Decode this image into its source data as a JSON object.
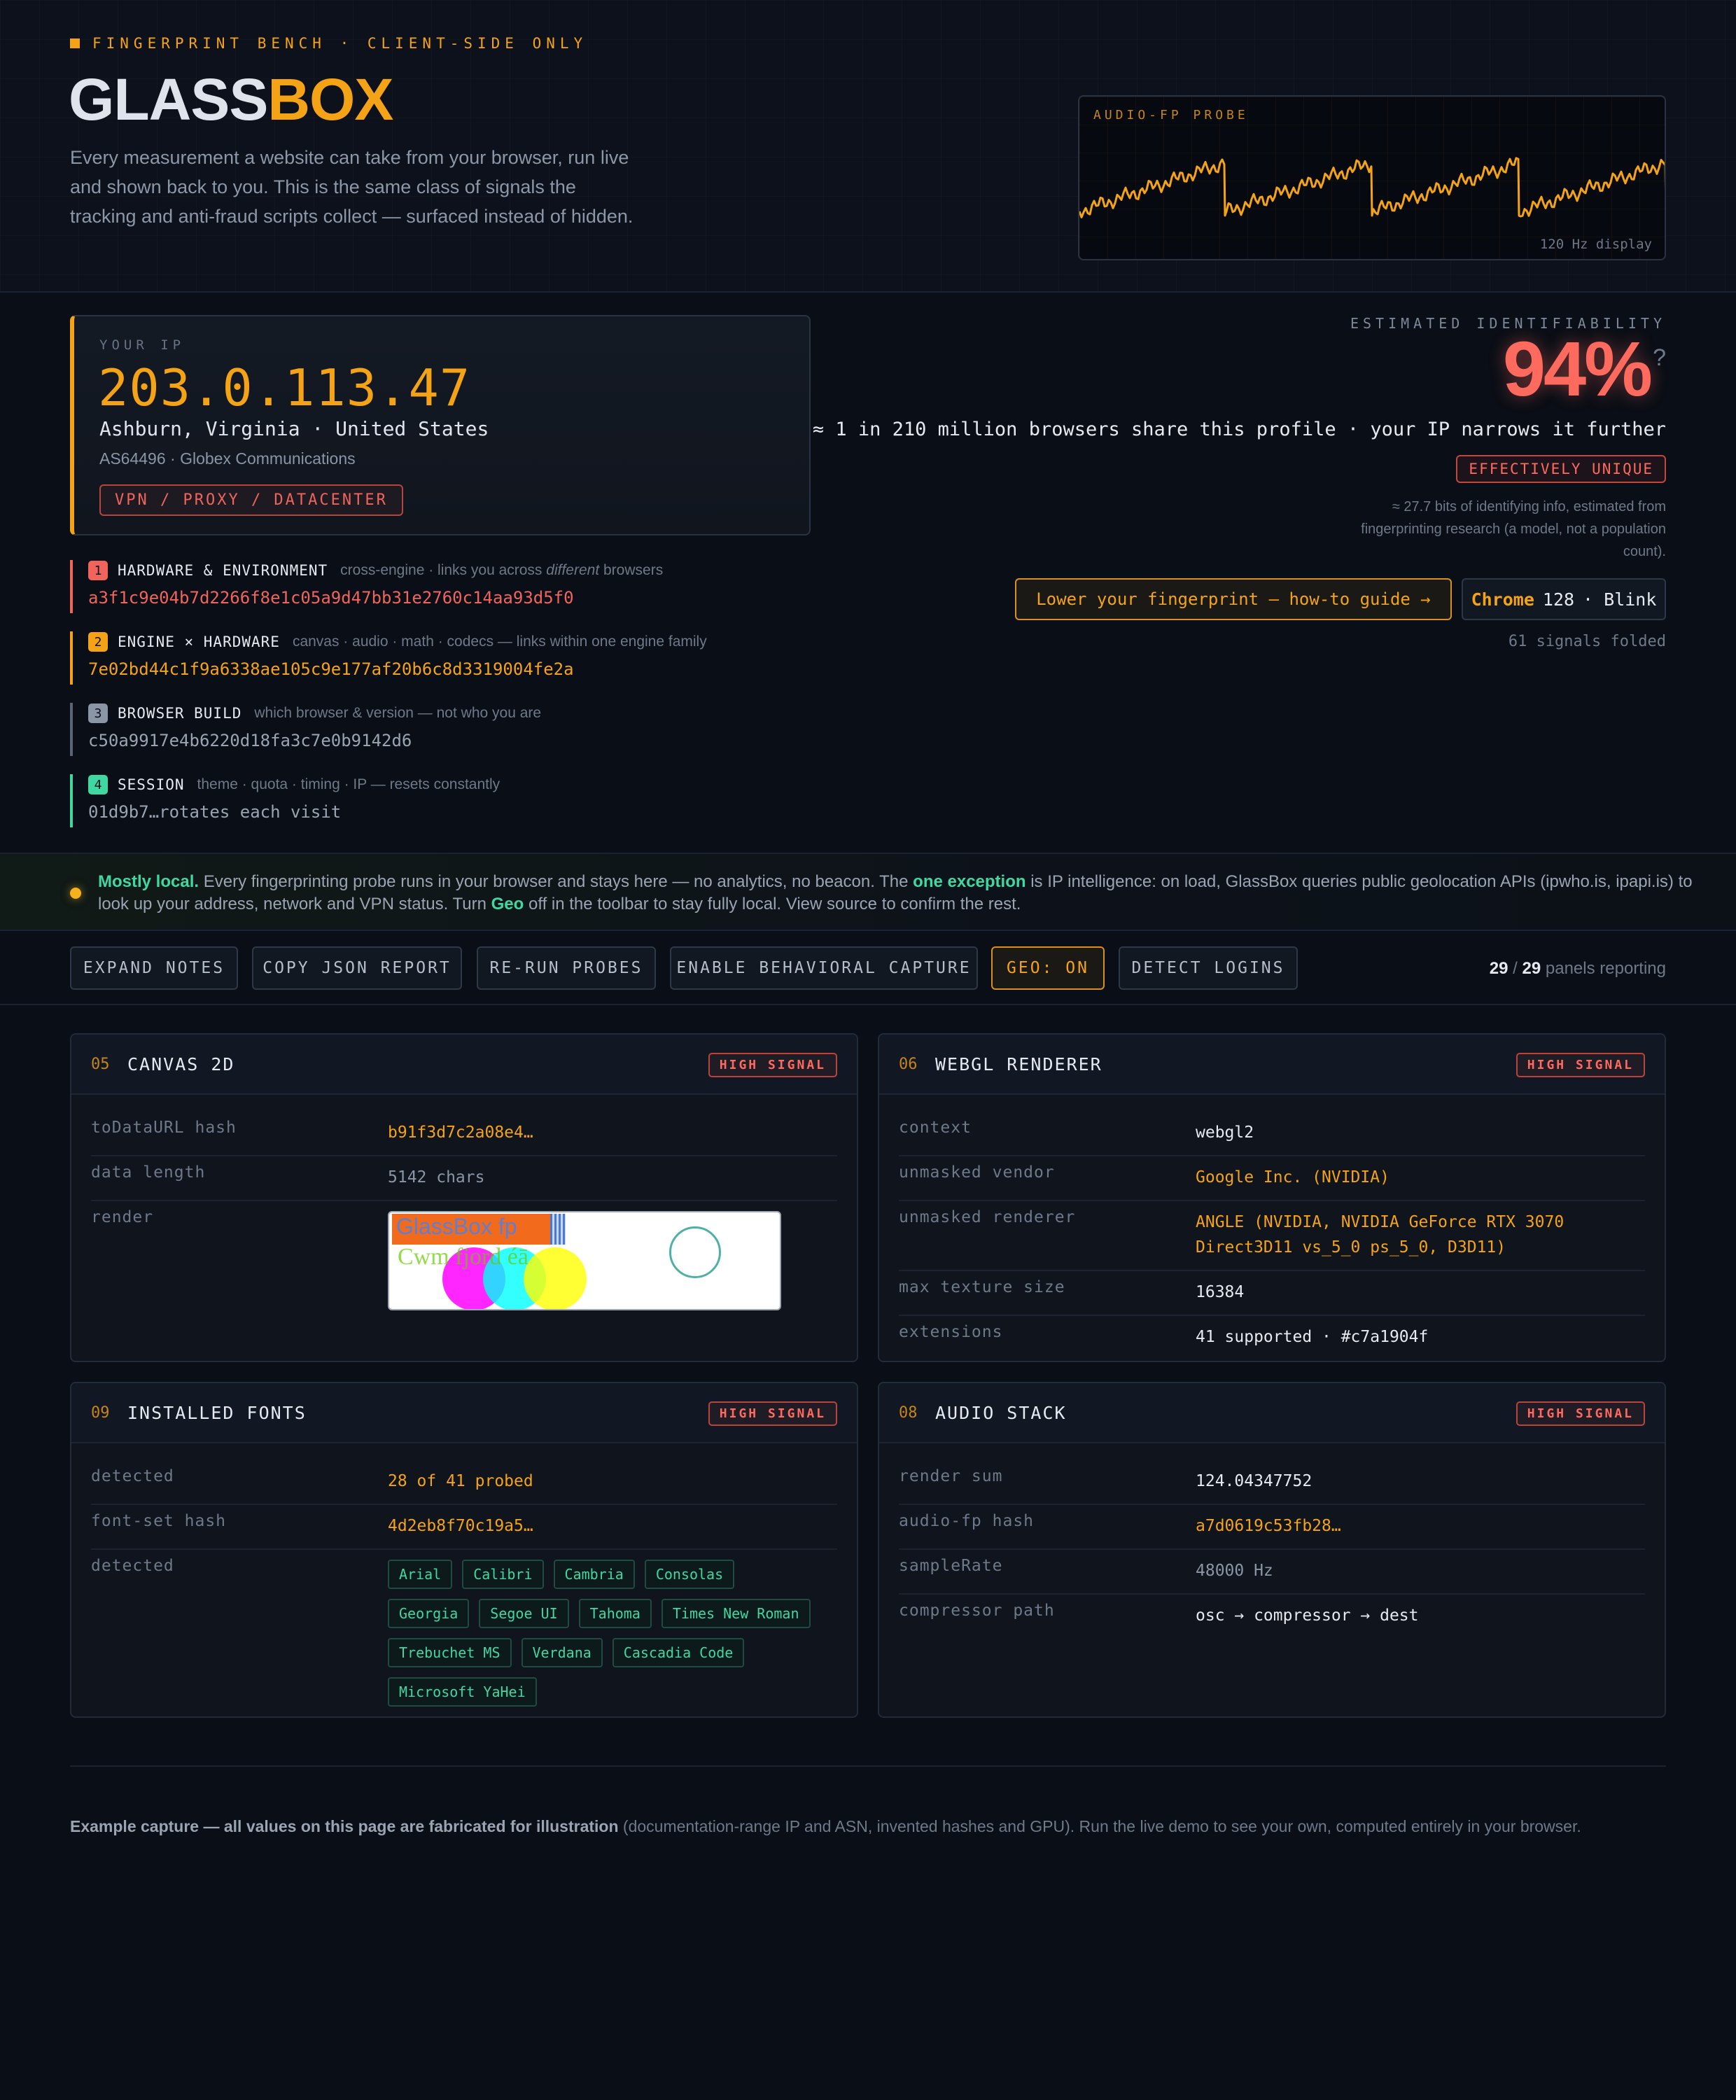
{
  "header": {
    "eyebrow": "FINGERPRINT BENCH · CLIENT-SIDE ONLY",
    "brand_main": "GLASS",
    "brand_accent": "BOX",
    "intro": "Every measurement a website can take from your browser, run live and shown back to you. This is the same class of signals the tracking and anti-fraud scripts collect — surfaced instead of hidden.",
    "probe": {
      "label": "AUDIO-FP PROBE",
      "caption": "120 Hz display",
      "color": "#f5a316"
    }
  },
  "ip_card": {
    "label": "YOUR IP",
    "ip": "203.0.113.47",
    "location": "Ashburn, Virginia · United States",
    "asn": "AS64496 · Globex Communications",
    "badge": "VPN / PROXY / DATACENTER"
  },
  "fingerprints": [
    {
      "num": "1",
      "title": "HARDWARE & ENVIRONMENT",
      "note_pre": "cross-engine · links you across ",
      "note_em": "different",
      "note_post": " browsers",
      "hash": "a3f1c9e04b7d2266f8e1c05a9d47bb31e2760c14aa93d5f0",
      "color": "#f0645c"
    },
    {
      "num": "2",
      "title": "ENGINE × HARDWARE",
      "note": "canvas · audio · math · codecs — links within one engine family",
      "hash": "7e02bd44c1f9a6338ae105c9e177af20b6c8d3319004fe2a",
      "color": "#f5a316"
    },
    {
      "num": "3",
      "title": "BROWSER BUILD",
      "note": "which browser & version — not who you are",
      "hash": "c50a9917e4b6220d18fa3c7e0b9142d6",
      "color": "#8a95a6"
    },
    {
      "num": "4",
      "title": "SESSION",
      "note": "theme · quota · timing · IP — resets constantly",
      "hash": "01d9b7…rotates each visit",
      "color": "#3fd8a0"
    }
  ],
  "identifiability": {
    "label": "ESTIMATED IDENTIFIABILITY",
    "percent": "94%",
    "help": "?",
    "line": "≈ 1 in 210 million browsers share this profile · your IP narrows it further",
    "badge": "EFFECTIVELY UNIQUE",
    "note": "≈ 27.7 bits of identifying info, estimated from fingerprinting research (a model, not a population count).",
    "guide_button": "Lower your fingerprint — how-to guide →",
    "engine": {
      "browser": "Chrome",
      "version": "128",
      "engine": "· Blink"
    },
    "folded": "61 signals folded"
  },
  "notice": {
    "lead": "Mostly local.",
    "part1": " Every fingerprinting probe runs in your browser and stays here — no analytics, no beacon. The ",
    "exception": "one exception",
    "part2": " is IP intelligence: on load, GlassBox queries public geolocation APIs (ipwho.is, ipapi.is) to look up your address, network and VPN status. Turn ",
    "geo": "Geo",
    "part3": " off in the toolbar to stay fully local. View source to confirm the rest."
  },
  "toolbar": {
    "expand": "EXPAND NOTES",
    "copy": "COPY JSON REPORT",
    "rerun": "RE-RUN PROBES",
    "behavioral": "ENABLE BEHAVIORAL CAPTURE",
    "geo": "GEO: ON",
    "logins": "DETECT LOGINS",
    "panels_count": "29",
    "panels_sep": " / ",
    "panels_total": "29",
    "panels_label": " panels reporting"
  },
  "panels": {
    "canvas": {
      "num": "05",
      "title": "CANVAS 2D",
      "badge": "HIGH SIGNAL",
      "rows": [
        {
          "key": "toDataURL hash",
          "value": "b91f3d7c2a08e4…"
        },
        {
          "key": "data length",
          "value": "5142 chars"
        },
        {
          "key": "render"
        }
      ],
      "render_text1": "GlassBox fp",
      "render_text2": "Cwm fjord éā"
    },
    "webgl": {
      "num": "06",
      "title": "WEBGL RENDERER",
      "badge": "HIGH SIGNAL",
      "rows": [
        {
          "key": "context",
          "value": "webgl2"
        },
        {
          "key": "unmasked vendor",
          "value": "Google Inc. (NVIDIA)"
        },
        {
          "key": "unmasked renderer",
          "value": "ANGLE (NVIDIA, NVIDIA GeForce RTX 3070 Direct3D11 vs_5_0 ps_5_0, D3D11)"
        },
        {
          "key": "max texture size",
          "value": "16384"
        },
        {
          "key": "extensions",
          "value": "41 supported · #c7a1904f"
        }
      ]
    },
    "fonts": {
      "num": "09",
      "title": "INSTALLED FONTS",
      "badge": "HIGH SIGNAL",
      "rows": [
        {
          "key": "detected",
          "value": "28 of 41 probed"
        },
        {
          "key": "font-set hash",
          "value": "4d2eb8f70c19a5…"
        },
        {
          "key": "detected"
        }
      ],
      "chips": [
        "Arial",
        "Calibri",
        "Cambria",
        "Consolas",
        "Georgia",
        "Segoe UI",
        "Tahoma",
        "Times New Roman",
        "Trebuchet MS",
        "Verdana",
        "Cascadia Code",
        "Microsoft YaHei"
      ]
    },
    "audio": {
      "num": "08",
      "title": "AUDIO STACK",
      "badge": "HIGH SIGNAL",
      "rows": [
        {
          "key": "render sum",
          "value": "124.04347752"
        },
        {
          "key": "audio-fp hash",
          "value": "a7d0619c53fb28…"
        },
        {
          "key": "sampleRate",
          "value": "48000 Hz"
        },
        {
          "key": "compressor path",
          "value": "osc → compressor → dest"
        }
      ]
    }
  },
  "footer": {
    "bold": "Example capture — all values on this page are fabricated for illustration",
    "rest": " (documentation-range IP and ASN, invented hashes and GPU). Run the live demo to see your own, computed entirely in your browser."
  }
}
